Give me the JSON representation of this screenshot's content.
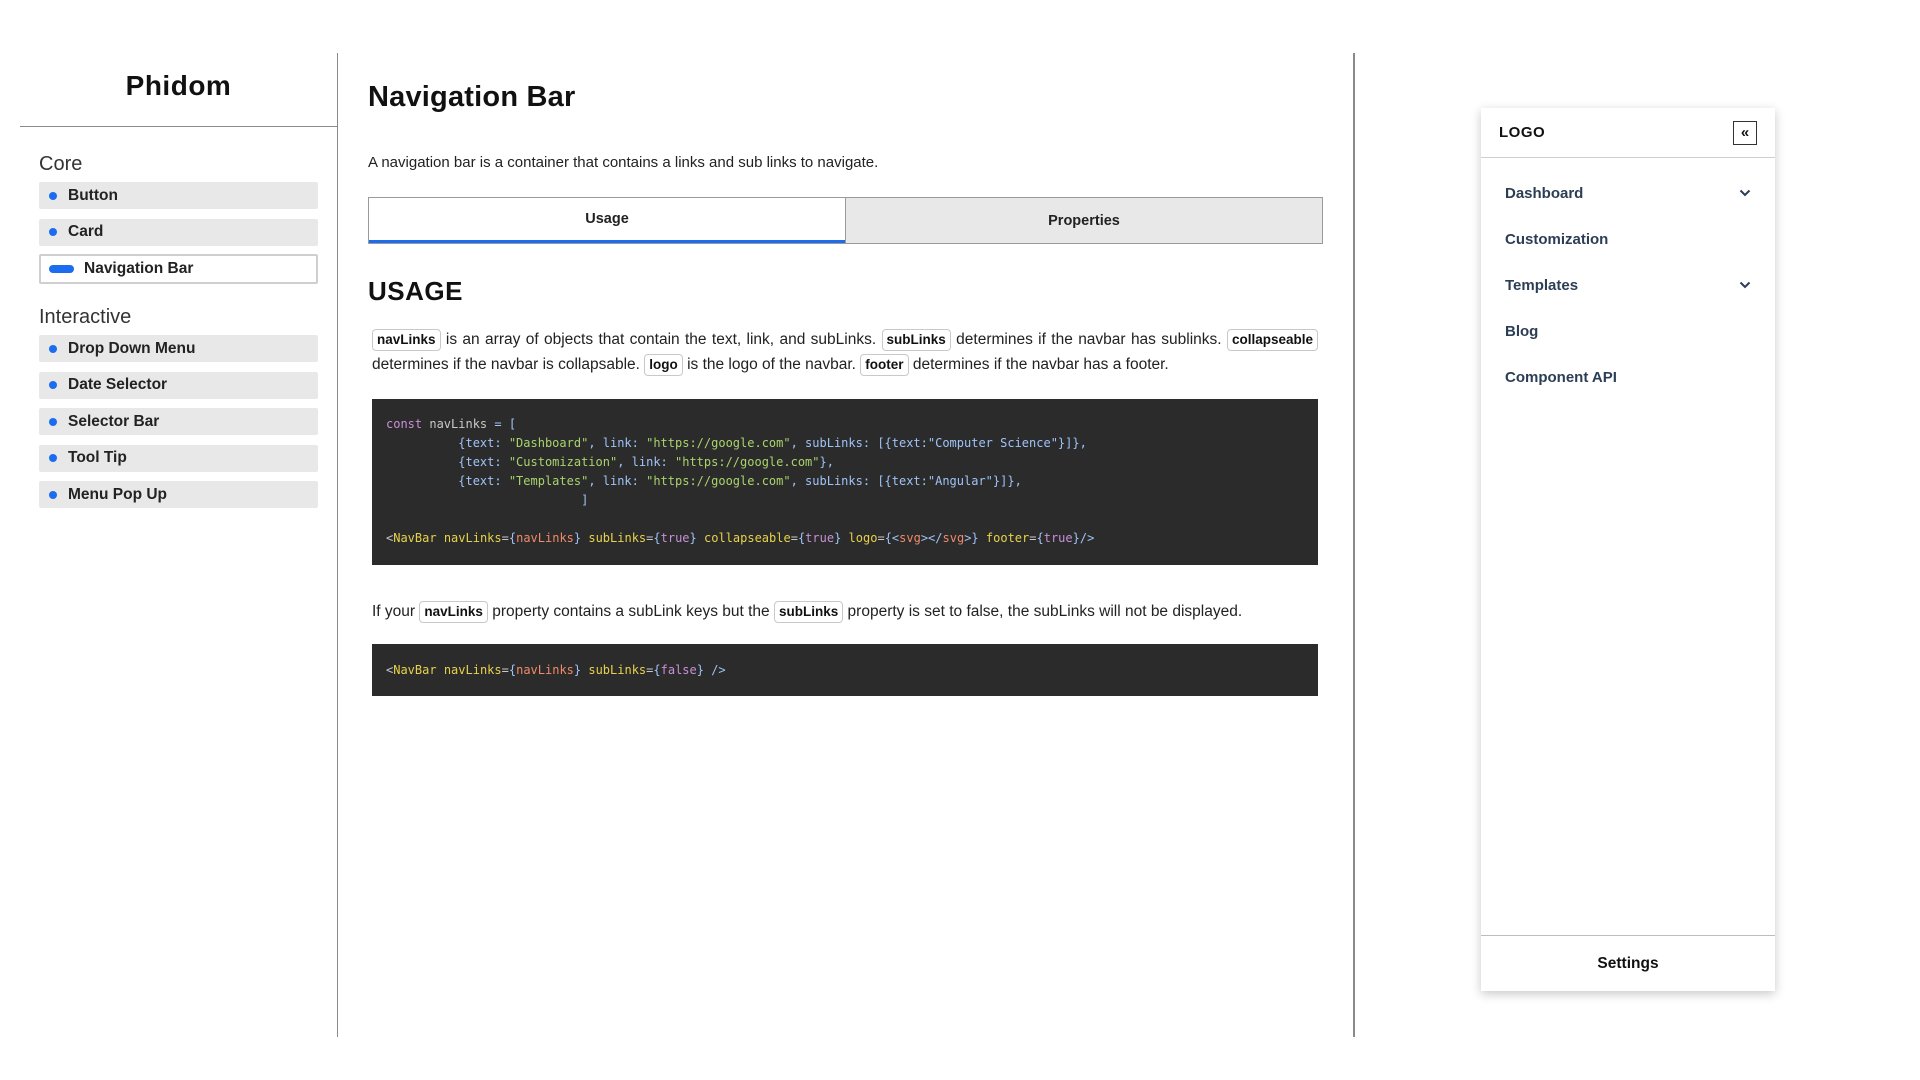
{
  "sidebar": {
    "brand": "Phidom",
    "sections": [
      {
        "title": "Core",
        "items": [
          "Button",
          "Card",
          "Navigation Bar"
        ]
      },
      {
        "title": "Interactive",
        "items": [
          "Drop Down Menu",
          "Date Selector",
          "Selector Bar",
          "Tool Tip",
          "Menu Pop Up"
        ]
      }
    ],
    "active_item": "Navigation Bar"
  },
  "main": {
    "title": "Navigation Bar",
    "intro": "A navigation bar is a container that contains a links and sub links to navigate.",
    "tabs": [
      {
        "label": "Usage",
        "active": true
      },
      {
        "label": "Properties",
        "active": false
      }
    ],
    "usage_heading": "USAGE",
    "para1": {
      "chip_navlinks": "navLinks",
      "t1": " is an array of objects that contain the text, link, and subLinks. ",
      "chip_sublinks": "subLinks",
      "t2": " determines if the navbar has sublinks. ",
      "chip_collapseable": "collapseable",
      "t3": " determines if the navbar is collapsable. ",
      "chip_logo": "logo",
      "t4": " is the logo of the navbar. ",
      "chip_footer": "footer",
      "t5": " determines if the navbar has a footer."
    },
    "code1": {
      "l1_kw": "const",
      "l1_name": "navLinks",
      "l1_rest": " = [",
      "rows": [
        {
          "text": "\"Dashboard\"",
          "link": "\"https://google.com\"",
          "sub": "[{text:\"Computer Science\"}]},"
        },
        {
          "text": "\"Customization\"",
          "link": "\"https://google.com\"",
          "sub": null
        },
        {
          "text": "\"Templates\"",
          "link": "\"https://google.com\"",
          "sub": "[{text:\"Angular\"}]},"
        }
      ],
      "close": "]",
      "jsx_tag": "NavBar",
      "jsx_line": "<NavBar navLinks={navLinks} subLinks={true} collapseable={true} logo={<svg></svg>} footer={true}/>"
    },
    "para2": {
      "t1": "If your ",
      "chip_navlinks": "navLinks",
      "t2": " property contains a subLink keys but the ",
      "chip_sublinks": "subLinks",
      "t3": " property is set to false, the subLinks will not be displayed."
    },
    "code2": {
      "jsx_line": "<NavBar navLinks={navLinks} subLinks={false} />"
    }
  },
  "navbar_preview": {
    "logo": "LOGO",
    "collapse_icon": "«",
    "links": [
      {
        "label": "Dashboard",
        "has_sublinks": true
      },
      {
        "label": "Customization",
        "has_sublinks": false
      },
      {
        "label": "Templates",
        "has_sublinks": true
      },
      {
        "label": "Blog",
        "has_sublinks": false
      },
      {
        "label": "Component API",
        "has_sublinks": false
      }
    ],
    "footer": "Settings"
  },
  "colors": {
    "accent": "#1c6cf0",
    "code_bg": "#2b2b2b",
    "item_bg": "#e8e8e8"
  }
}
